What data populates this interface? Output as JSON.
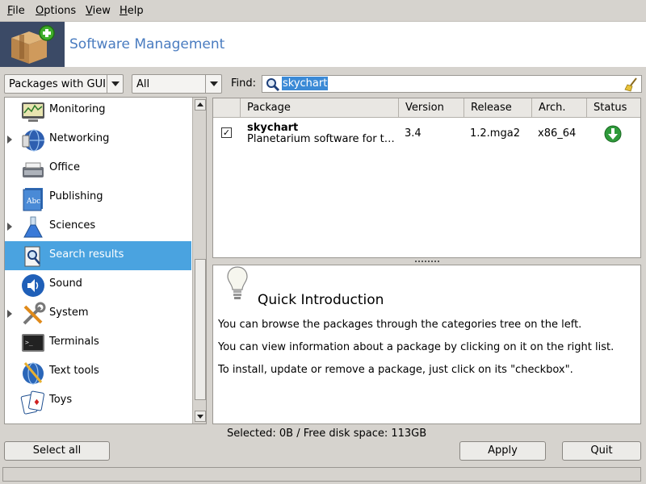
{
  "menu": {
    "file": "File",
    "options": "Options",
    "view": "View",
    "help": "Help"
  },
  "header": {
    "title": "Software Management",
    "app_icon": "package-box-add-icon"
  },
  "filters": {
    "package_type": "Packages with GUI",
    "status": "All",
    "find_label": "Find:",
    "search_value": "skychart"
  },
  "categories": [
    {
      "label": "Monitoring",
      "icon": "monitor-chart-icon",
      "expandable": false,
      "selected": false
    },
    {
      "label": "Networking",
      "icon": "globe-network-icon",
      "expandable": true,
      "selected": false
    },
    {
      "label": "Office",
      "icon": "typewriter-icon",
      "expandable": false,
      "selected": false
    },
    {
      "label": "Publishing",
      "icon": "book-abc-icon",
      "expandable": false,
      "selected": false
    },
    {
      "label": "Sciences",
      "icon": "flask-icon",
      "expandable": true,
      "selected": false
    },
    {
      "label": "Search results",
      "icon": "search-results-icon",
      "expandable": false,
      "selected": true
    },
    {
      "label": "Sound",
      "icon": "speaker-icon",
      "expandable": false,
      "selected": false
    },
    {
      "label": "System",
      "icon": "tools-icon",
      "expandable": true,
      "selected": false
    },
    {
      "label": "Terminals",
      "icon": "terminal-icon",
      "expandable": false,
      "selected": false
    },
    {
      "label": "Text tools",
      "icon": "text-tools-icon",
      "expandable": false,
      "selected": false
    },
    {
      "label": "Toys",
      "icon": "playing-cards-icon",
      "expandable": false,
      "selected": false
    }
  ],
  "package_table": {
    "columns": [
      "Package",
      "Version",
      "Release",
      "Arch.",
      "Status"
    ],
    "rows": [
      {
        "checked": true,
        "name": "skychart",
        "summary": "Planetarium software for t…",
        "version": "3.4",
        "release": "1.2.mga2",
        "arch": "x86_64",
        "status_icon": "download-icon"
      }
    ]
  },
  "info": {
    "title": "Quick Introduction",
    "lines": [
      "You can browse the packages through the categories tree on the left.",
      "You can view information about a package by clicking on it on the right list.",
      "To install, update or remove a package, just click on its \"checkbox\"."
    ]
  },
  "status_bar": "Selected: 0B / Free disk space: 113GB",
  "buttons": {
    "select_all": "Select all",
    "apply": "Apply",
    "quit": "Quit"
  },
  "colors": {
    "selection": "#4aa3e0",
    "title": "#4a7cc0",
    "status_ok": "#2e9a3a"
  }
}
